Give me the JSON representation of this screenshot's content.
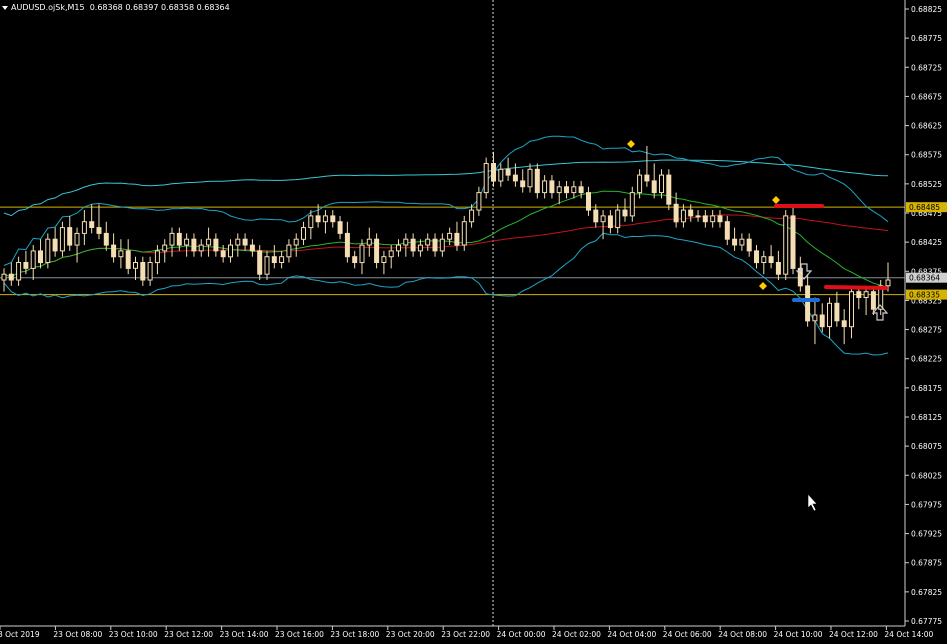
{
  "header": {
    "symbol": "AUDUSD.ojSk",
    "timeframe": "M15",
    "open": "0.68368",
    "high": "0.68397",
    "low": "0.68358",
    "close": "0.68364"
  },
  "colors": {
    "background": "#000000",
    "candle": "#f5deb3",
    "bb_band": "#1fa5c9",
    "mid_line": "#2bb52b",
    "ma_red": "#c0141a",
    "ma_cyan": "#3ac6d6",
    "hline": "#d4b400",
    "price_line": "#7f8fa0",
    "marker": "#ffcc00",
    "red_level": "#e0101a",
    "blue_level": "#1a6fd6"
  },
  "price_scale": {
    "labels": [
      "0.68825",
      "0.68775",
      "0.68725",
      "0.68675",
      "0.68625",
      "0.68575",
      "0.68525",
      "0.68475",
      "0.68425",
      "0.68375",
      "0.68325",
      "0.68275",
      "0.68225",
      "0.68175",
      "0.68125",
      "0.68075",
      "0.68025",
      "0.67975",
      "0.67925",
      "0.67875",
      "0.67825",
      "0.67775"
    ],
    "current_label": "0.68364",
    "level_labels": [
      "0.68485",
      "0.68335"
    ]
  },
  "time_scale": {
    "labels": [
      "3 Oct 2019",
      "23 Oct 08:00",
      "23 Oct 10:00",
      "23 Oct 12:00",
      "23 Oct 14:00",
      "23 Oct 16:00",
      "23 Oct 18:00",
      "23 Oct 20:00",
      "23 Oct 22:00",
      "24 Oct 00:00",
      "24 Oct 02:00",
      "24 Oct 04:00",
      "24 Oct 06:00",
      "24 Oct 08:00",
      "24 Oct 10:00",
      "24 Oct 12:00",
      "24 Oct 14:00"
    ]
  },
  "chart_data": {
    "type": "candlestick",
    "ylim": [
      0.67765,
      0.68845
    ],
    "ohlc": [
      [
        0.6836,
        0.6838,
        0.6834,
        0.6837
      ],
      [
        0.6837,
        0.6839,
        0.6835,
        0.6836
      ],
      [
        0.6836,
        0.684,
        0.6835,
        0.6839
      ],
      [
        0.6839,
        0.6841,
        0.6837,
        0.6838
      ],
      [
        0.6838,
        0.6842,
        0.6836,
        0.6841
      ],
      [
        0.6841,
        0.6843,
        0.6838,
        0.6839
      ],
      [
        0.6839,
        0.6844,
        0.6838,
        0.6843
      ],
      [
        0.6843,
        0.6845,
        0.684,
        0.6841
      ],
      [
        0.6841,
        0.6846,
        0.684,
        0.6845
      ],
      [
        0.6845,
        0.6847,
        0.6841,
        0.6842
      ],
      [
        0.6842,
        0.6845,
        0.6839,
        0.6844
      ],
      [
        0.6844,
        0.6848,
        0.6842,
        0.6846
      ],
      [
        0.6846,
        0.6849,
        0.6844,
        0.6845
      ],
      [
        0.6845,
        0.6849,
        0.6843,
        0.6844
      ],
      [
        0.6844,
        0.6846,
        0.6841,
        0.6842
      ],
      [
        0.6842,
        0.6844,
        0.6839,
        0.684
      ],
      [
        0.684,
        0.6843,
        0.6838,
        0.6841
      ],
      [
        0.6841,
        0.6843,
        0.6837,
        0.6838
      ],
      [
        0.6838,
        0.684,
        0.6836,
        0.6839
      ],
      [
        0.6839,
        0.684,
        0.6835,
        0.6836
      ],
      [
        0.6836,
        0.684,
        0.6835,
        0.6839
      ],
      [
        0.6839,
        0.6842,
        0.6837,
        0.6841
      ],
      [
        0.6841,
        0.6843,
        0.6839,
        0.6842
      ],
      [
        0.6842,
        0.6845,
        0.684,
        0.6844
      ],
      [
        0.6844,
        0.6845,
        0.6841,
        0.6842
      ],
      [
        0.6842,
        0.6844,
        0.684,
        0.6843
      ],
      [
        0.6843,
        0.6844,
        0.684,
        0.6841
      ],
      [
        0.6841,
        0.6843,
        0.684,
        0.6842
      ],
      [
        0.6842,
        0.6845,
        0.684,
        0.6843
      ],
      [
        0.6843,
        0.6844,
        0.684,
        0.6841
      ],
      [
        0.6841,
        0.6842,
        0.6839,
        0.684
      ],
      [
        0.684,
        0.6843,
        0.6839,
        0.6842
      ],
      [
        0.6842,
        0.6844,
        0.684,
        0.6843
      ],
      [
        0.6843,
        0.6844,
        0.6841,
        0.6842
      ],
      [
        0.6842,
        0.6843,
        0.684,
        0.6841
      ],
      [
        0.6841,
        0.6842,
        0.6836,
        0.6837
      ],
      [
        0.6837,
        0.6841,
        0.6836,
        0.684
      ],
      [
        0.684,
        0.6842,
        0.6838,
        0.6839
      ],
      [
        0.6839,
        0.6841,
        0.6838,
        0.684
      ],
      [
        0.684,
        0.6843,
        0.6839,
        0.6842
      ],
      [
        0.6842,
        0.6844,
        0.684,
        0.6843
      ],
      [
        0.6843,
        0.6846,
        0.6842,
        0.6845
      ],
      [
        0.6845,
        0.6848,
        0.6843,
        0.6847
      ],
      [
        0.6847,
        0.6849,
        0.6845,
        0.6846
      ],
      [
        0.6846,
        0.6848,
        0.6844,
        0.6847
      ],
      [
        0.6847,
        0.6848,
        0.6845,
        0.6846
      ],
      [
        0.6846,
        0.6847,
        0.6843,
        0.6844
      ],
      [
        0.6844,
        0.6846,
        0.6839,
        0.684
      ],
      [
        0.684,
        0.6841,
        0.6838,
        0.6839
      ],
      [
        0.6839,
        0.6843,
        0.6837,
        0.6842
      ],
      [
        0.6842,
        0.6845,
        0.684,
        0.6843
      ],
      [
        0.6843,
        0.6844,
        0.6838,
        0.6839
      ],
      [
        0.6839,
        0.6841,
        0.6837,
        0.684
      ],
      [
        0.684,
        0.6842,
        0.6838,
        0.6841
      ],
      [
        0.6841,
        0.6843,
        0.684,
        0.6842
      ],
      [
        0.6842,
        0.6844,
        0.684,
        0.6843
      ],
      [
        0.6843,
        0.6844,
        0.684,
        0.6841
      ],
      [
        0.6841,
        0.6843,
        0.684,
        0.6842
      ],
      [
        0.6842,
        0.6844,
        0.6841,
        0.6843
      ],
      [
        0.6843,
        0.6844,
        0.684,
        0.6841
      ],
      [
        0.6841,
        0.6844,
        0.684,
        0.6843
      ],
      [
        0.6843,
        0.6845,
        0.6842,
        0.6844
      ],
      [
        0.6844,
        0.6846,
        0.6841,
        0.6842
      ],
      [
        0.6842,
        0.6847,
        0.6841,
        0.6846
      ],
      [
        0.6846,
        0.6849,
        0.6845,
        0.6848
      ],
      [
        0.6848,
        0.6852,
        0.6847,
        0.6851
      ],
      [
        0.6851,
        0.6857,
        0.685,
        0.6856
      ],
      [
        0.6856,
        0.6858,
        0.6852,
        0.6853
      ],
      [
        0.6853,
        0.6856,
        0.6852,
        0.6855
      ],
      [
        0.6855,
        0.6857,
        0.6853,
        0.6854
      ],
      [
        0.6854,
        0.6856,
        0.6852,
        0.6853
      ],
      [
        0.6853,
        0.6855,
        0.6851,
        0.6852
      ],
      [
        0.6852,
        0.6856,
        0.6851,
        0.6855
      ],
      [
        0.6855,
        0.6856,
        0.685,
        0.6851
      ],
      [
        0.6851,
        0.6854,
        0.685,
        0.6853
      ],
      [
        0.6853,
        0.6854,
        0.685,
        0.6851
      ],
      [
        0.6851,
        0.6853,
        0.6849,
        0.6852
      ],
      [
        0.6852,
        0.6853,
        0.685,
        0.6851
      ],
      [
        0.6851,
        0.6853,
        0.685,
        0.6852
      ],
      [
        0.6852,
        0.6853,
        0.685,
        0.6851
      ],
      [
        0.6851,
        0.6852,
        0.6847,
        0.6848
      ],
      [
        0.6848,
        0.6849,
        0.6845,
        0.6846
      ],
      [
        0.6846,
        0.6848,
        0.6843,
        0.6847
      ],
      [
        0.6847,
        0.6848,
        0.6844,
        0.6845
      ],
      [
        0.6845,
        0.6849,
        0.6844,
        0.6848
      ],
      [
        0.6848,
        0.685,
        0.6846,
        0.6847
      ],
      [
        0.6847,
        0.6852,
        0.6846,
        0.6851
      ],
      [
        0.6851,
        0.6855,
        0.685,
        0.6854
      ],
      [
        0.6854,
        0.6859,
        0.6852,
        0.6853
      ],
      [
        0.6853,
        0.6856,
        0.685,
        0.6851
      ],
      [
        0.6851,
        0.6855,
        0.685,
        0.6854
      ],
      [
        0.6854,
        0.6855,
        0.6848,
        0.6849
      ],
      [
        0.6849,
        0.6851,
        0.6845,
        0.6846
      ],
      [
        0.6846,
        0.6849,
        0.6845,
        0.6848
      ],
      [
        0.6848,
        0.6849,
        0.6846,
        0.6847
      ],
      [
        0.6847,
        0.6848,
        0.6846,
        0.6847
      ],
      [
        0.6847,
        0.6848,
        0.6845,
        0.6846
      ],
      [
        0.6846,
        0.6848,
        0.6845,
        0.6847
      ],
      [
        0.6847,
        0.6848,
        0.6845,
        0.6846
      ],
      [
        0.6846,
        0.6847,
        0.6842,
        0.6843
      ],
      [
        0.6843,
        0.6845,
        0.6841,
        0.6842
      ],
      [
        0.6842,
        0.6844,
        0.6841,
        0.6843
      ],
      [
        0.6843,
        0.6844,
        0.684,
        0.6841
      ],
      [
        0.6841,
        0.6842,
        0.6838,
        0.6839
      ],
      [
        0.6839,
        0.6841,
        0.6837,
        0.684
      ],
      [
        0.684,
        0.6842,
        0.6838,
        0.6839
      ],
      [
        0.6839,
        0.6841,
        0.6836,
        0.6837
      ],
      [
        0.6837,
        0.6848,
        0.6836,
        0.6847
      ],
      [
        0.6847,
        0.6849,
        0.6837,
        0.6838
      ],
      [
        0.6838,
        0.684,
        0.6834,
        0.6835
      ],
      [
        0.6835,
        0.6837,
        0.6828,
        0.6829
      ],
      [
        0.6829,
        0.6833,
        0.6825,
        0.683
      ],
      [
        0.683,
        0.6832,
        0.6827,
        0.6828
      ],
      [
        0.6828,
        0.6833,
        0.6826,
        0.6832
      ],
      [
        0.6832,
        0.6834,
        0.6828,
        0.6829
      ],
      [
        0.6829,
        0.6831,
        0.6825,
        0.6828
      ],
      [
        0.6828,
        0.6835,
        0.6826,
        0.6834
      ],
      [
        0.6834,
        0.6835,
        0.6831,
        0.6833
      ],
      [
        0.6833,
        0.6835,
        0.683,
        0.6834
      ],
      [
        0.6834,
        0.6835,
        0.683,
        0.6831
      ],
      [
        0.6831,
        0.6836,
        0.683,
        0.6835
      ],
      [
        0.6835,
        0.6839,
        0.6834,
        0.6836
      ]
    ]
  }
}
